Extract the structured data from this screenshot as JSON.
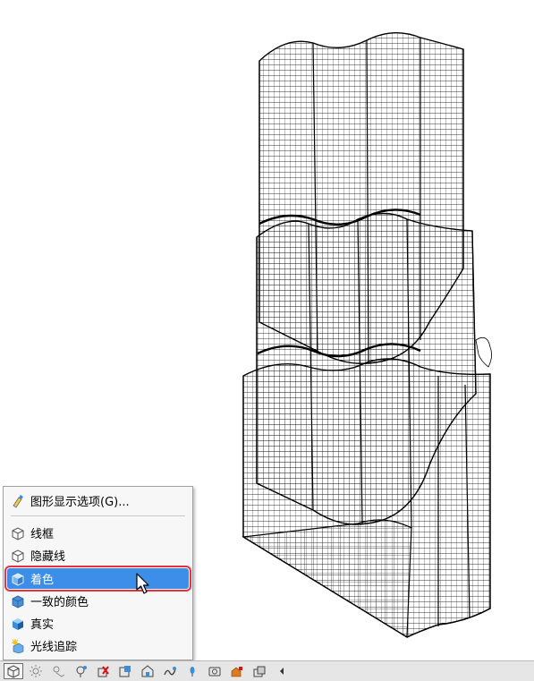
{
  "menu": {
    "items": [
      {
        "label": "图形显示选项(G)...",
        "icon": "brush-icon"
      },
      {
        "label": "线框",
        "icon": "wireframe-cube-icon"
      },
      {
        "label": "隐藏线",
        "icon": "hidden-line-cube-icon"
      },
      {
        "label": "着色",
        "icon": "shaded-cube-icon",
        "selected": true
      },
      {
        "label": "一致的颜色",
        "icon": "consistent-colors-cube-icon"
      },
      {
        "label": "真实",
        "icon": "realistic-cube-icon"
      },
      {
        "label": "光线追踪",
        "icon": "ray-trace-icon"
      }
    ]
  },
  "toolbar": {
    "buttons": [
      "visual-style-icon",
      "sun-off-icon",
      "shadows-off-icon",
      "temporary-hide-icon",
      "reveal-hidden-icon",
      "temporary-view-properties-icon",
      "worksharing-icon",
      "analytical-model-icon",
      "highlight-icon",
      "crop-view-icon",
      "render-icon",
      "3d-view-lock-icon",
      "collapse-arrow-icon"
    ]
  },
  "colors": {
    "selection": "#3d8ee8",
    "highlight_border": "#e8313a"
  }
}
